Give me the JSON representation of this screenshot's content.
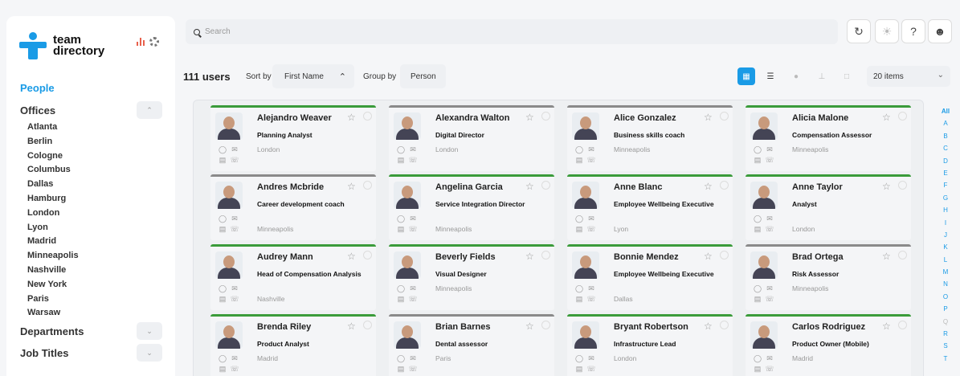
{
  "app": {
    "logo_line1": "team",
    "logo_line2": "directory"
  },
  "sidebar": {
    "people": "People",
    "offices_title": "Offices",
    "offices": [
      "Atlanta",
      "Berlin",
      "Cologne",
      "Columbus",
      "Dallas",
      "Hamburg",
      "London",
      "Lyon",
      "Madrid",
      "Minneapolis",
      "Nashville",
      "New York",
      "Paris",
      "Warsaw"
    ],
    "departments_title": "Departments",
    "job_titles_title": "Job Titles"
  },
  "search": {
    "placeholder": "Search"
  },
  "toolbar": {
    "count": "111 users",
    "sort_label": "Sort by",
    "sort_value": "First Name",
    "group_label": "Group by",
    "group_value": "Person",
    "items": "20 items"
  },
  "icons": {
    "active_color": "#1a9be6",
    "status_green": "#3a9b3a",
    "status_grey": "#8a8a8a"
  },
  "cards": [
    {
      "name": "Alejandro Weaver",
      "job": "Planning Analyst",
      "office": "London",
      "status": "green"
    },
    {
      "name": "Alexandra Walton",
      "job": "Digital Director",
      "office": "London",
      "status": "grey"
    },
    {
      "name": "Alice Gonzalez",
      "job": "Business skills coach",
      "office": "Minneapolis",
      "status": "grey"
    },
    {
      "name": "Alicia Malone",
      "job": "Compensation Assessor",
      "office": "Minneapolis",
      "status": "green"
    },
    {
      "name": "Andres Mcbride",
      "job": "Career development coach",
      "office": "Minneapolis",
      "status": "grey"
    },
    {
      "name": "Angelina Garcia",
      "job": "Service Integration Director",
      "office": "Minneapolis",
      "status": "green"
    },
    {
      "name": "Anne Blanc",
      "job": "Employee Wellbeing Executive",
      "office": "Lyon",
      "status": "green"
    },
    {
      "name": "Anne Taylor",
      "job": "Analyst",
      "office": "London",
      "status": "green"
    },
    {
      "name": "Audrey Mann",
      "job": "Head of Compensation Analysis",
      "office": "Nashville",
      "status": "green"
    },
    {
      "name": "Beverly Fields",
      "job": "Visual Designer",
      "office": "Minneapolis",
      "status": "green"
    },
    {
      "name": "Bonnie Mendez",
      "job": "Employee Wellbeing Executive",
      "office": "Dallas",
      "status": "green"
    },
    {
      "name": "Brad Ortega",
      "job": "Risk Assessor",
      "office": "Minneapolis",
      "status": "grey"
    },
    {
      "name": "Brenda Riley",
      "job": "Product Analyst",
      "office": "Madrid",
      "status": "green"
    },
    {
      "name": "Brian Barnes",
      "job": "Dental assessor",
      "office": "Paris",
      "status": "grey"
    },
    {
      "name": "Bryant Robertson",
      "job": "Infrastructure Lead",
      "office": "London",
      "status": "green"
    },
    {
      "name": "Carlos Rodriguez",
      "job": "Product Owner (Mobile)",
      "office": "Madrid",
      "status": "green"
    }
  ],
  "alphabet": [
    "All",
    "A",
    "B",
    "C",
    "D",
    "E",
    "F",
    "G",
    "H",
    "I",
    "J",
    "K",
    "L",
    "M",
    "N",
    "O",
    "P",
    "Q",
    "R",
    "S",
    "T"
  ]
}
